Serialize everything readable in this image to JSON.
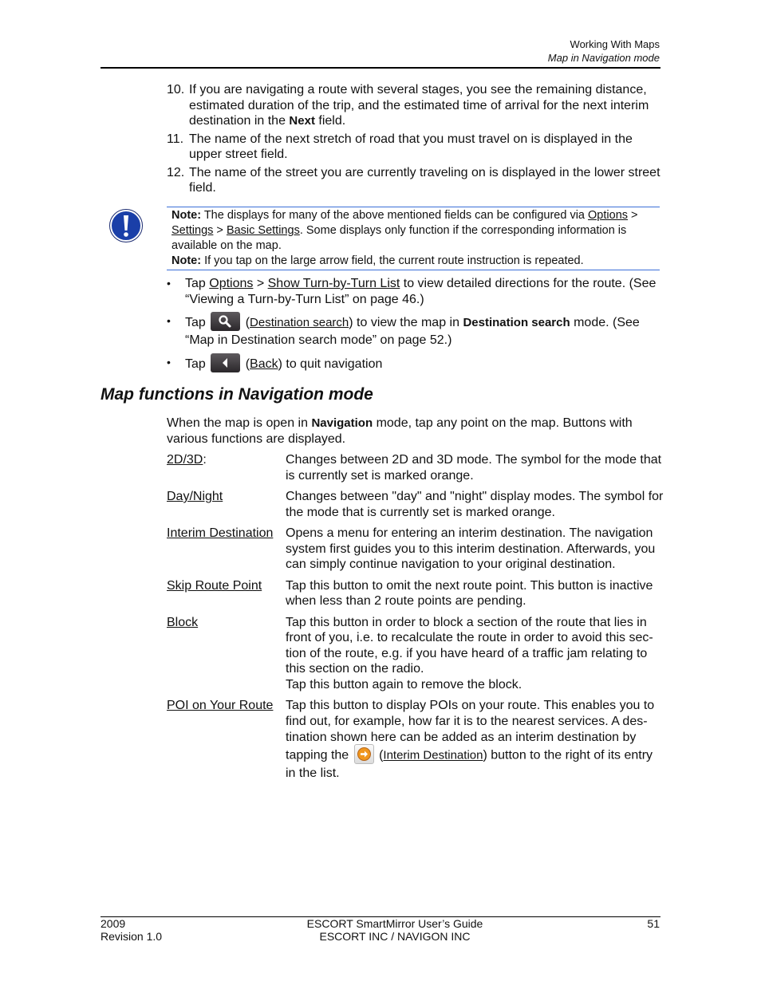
{
  "header": {
    "chapter": "Working With Maps",
    "section": "Map in Navigation mode"
  },
  "numbered_list": [
    {
      "num": "10.",
      "parts": [
        "If you are navigating a route with several stages, you see the remaining distance, estimated duration of the trip, and the estimated time of arrival for the next interim destination in the ",
        "Next",
        " field."
      ]
    },
    {
      "num": "11.",
      "text": "The name of the next stretch of road that you must travel on is displayed in the upper street field."
    },
    {
      "num": "12.",
      "text": "The name of the street you are currently traveling on is displayed in the lower street field."
    }
  ],
  "note": {
    "icon": "exclamation-icon",
    "note1_label": "Note:",
    "note1_text_a": " The displays for many of the above mentioned fields can be configured via ",
    "link_options": "Options",
    "sep": " > ",
    "link_settings": "Settings",
    "link_basic_settings": "Basic Settings",
    "note1_text_b": ". Some displays only function if the corresponding information is available on the map.",
    "note2_label": "Note:",
    "note2_text": " If you tap on the large arrow field, the current route instruction is repeated."
  },
  "bullets": {
    "b1_tap": "Tap ",
    "b1_link1": "Options",
    "b1_sep": " > ",
    "b1_link2": "Show Turn-by-Turn List",
    "b1_text": " to view detailed directions for the route. (See “Viewing a Turn-by-Turn List” on page 46.)",
    "b2_tap": "Tap ",
    "b2_icon": "magnifier-icon",
    "b2_open": " (",
    "b2_link": "Destination search",
    "b2_text_a": ") to view the map in ",
    "b2_bold": "Destination search",
    "b2_text_b": " mode. (See “Map in Destination search mode” on page 52.)",
    "b3_tap": "Tap ",
    "b3_icon": "back-arrow-icon",
    "b3_open": " (",
    "b3_link": "Back",
    "b3_text": ") to quit navigation"
  },
  "section": {
    "title": "Map functions in Navigation mode",
    "intro_a": "When the map is open in ",
    "intro_bold": "Navigation",
    "intro_b": " mode, tap any point on the map. Buttons with various functions are displayed."
  },
  "definitions": [
    {
      "term": "2D/3D",
      "term_suffix": ":",
      "desc": "Changes between 2D and 3D mode. The symbol for the mode that is currently set is marked orange."
    },
    {
      "term": "Day/Night",
      "term_suffix": "",
      "desc": "Changes between \"day\" and \"night\" display modes. The symbol for the mode that is currently set is marked orange."
    },
    {
      "term": "Interim Destination",
      "term_suffix": "",
      "desc": "Opens a menu for entering an interim destination. The navigation system first guides you to this interim destination. Afterwards, you can simply continue navigation to your original destination."
    },
    {
      "term": "Skip Route Point",
      "term_suffix": "",
      "desc": "Tap this button to omit the next route point. This button is inactive when less than 2 route points are pending."
    },
    {
      "term": "Block",
      "term_suffix": "",
      "desc": "Tap this button in order to block a section of the route that lies in front of you, i.e. to recalculate the route in order to avoid this sec-tion of the route, e.g. if you have heard of a traffic jam relating to this section on the radio.",
      "desc2": "Tap this button again to remove the block."
    },
    {
      "term": "POI on Your Route",
      "term_suffix": "",
      "desc_a": "Tap this button to display POIs on your route. This enables you to find out, for example, how far it is to the nearest services. A des-tination shown here can be added as an interim destination by tapping the ",
      "icon": "interim-destination-arrow-icon",
      "desc_open": " (",
      "desc_link": "Interim Destination",
      "desc_b": ") button to the right of its entry in the list."
    }
  ],
  "footer": {
    "year": "2009",
    "revision": "Revision 1.0",
    "title": "ESCORT SmartMirror User’s Guide",
    "company": "ESCORT INC / NAVIGON INC",
    "page": "51"
  },
  "colors": {
    "note_rule": "#3a6fd8",
    "note_icon": "#1a3fa8",
    "interim_icon": "#f0961e"
  }
}
